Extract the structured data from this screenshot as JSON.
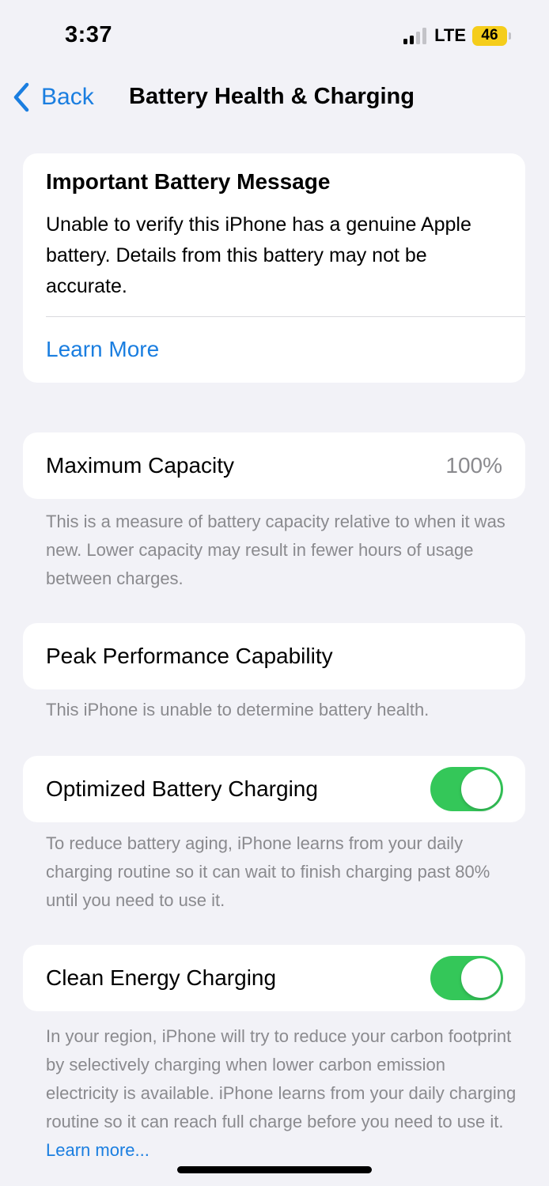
{
  "status_bar": {
    "time": "3:37",
    "network": "LTE",
    "battery_level": "46",
    "signal_bars": 2,
    "signal_bars_total": 4,
    "battery_color": "#f5cd1b"
  },
  "nav": {
    "back_label": "Back",
    "title": "Battery Health & Charging",
    "back_icon": "chevron-left-icon"
  },
  "battery_message": {
    "title": "Important Battery Message",
    "body": "Unable to verify this iPhone has a genuine Apple battery. Details from this battery may not be accurate.",
    "link": "Learn More"
  },
  "maximum_capacity": {
    "label": "Maximum Capacity",
    "value": "100%",
    "footnote": "This is a measure of battery capacity relative to when it was new. Lower capacity may result in fewer hours of usage between charges."
  },
  "peak_performance": {
    "label": "Peak Performance Capability",
    "footnote": "This iPhone is unable to determine battery health."
  },
  "optimized_charging": {
    "label": "Optimized Battery Charging",
    "enabled": true,
    "footnote": "To reduce battery aging, iPhone learns from your daily charging routine so it can wait to finish charging past 80% until you need to use it."
  },
  "clean_energy": {
    "label": "Clean Energy Charging",
    "enabled": true,
    "footnote": "In your region, iPhone will try to reduce your carbon footprint by selectively charging when lower carbon emission electricity is available. iPhone learns from your daily charging routine so it can reach full charge before you need to use it.",
    "footnote_link": "Learn more..."
  },
  "colors": {
    "accent": "#1a7ee0",
    "toggle_on": "#34c759",
    "background": "#f2f2f7",
    "secondary_text": "#8a8a8e"
  }
}
